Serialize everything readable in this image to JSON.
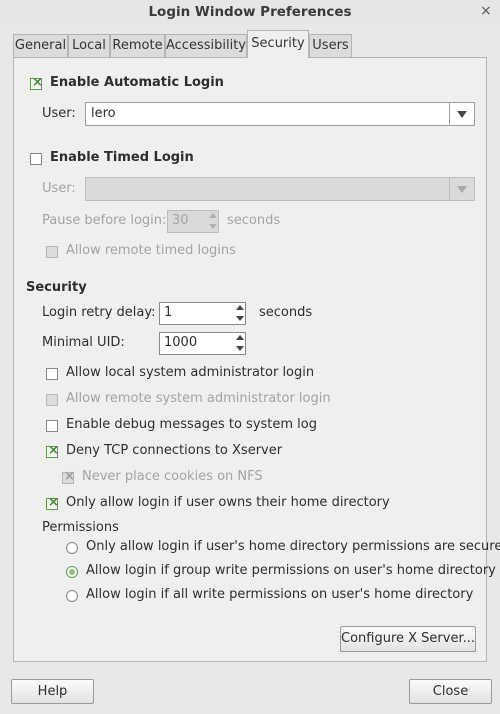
{
  "window": {
    "title": "Login Window Preferences",
    "close_glyph": "×"
  },
  "tabs": [
    {
      "label": "General"
    },
    {
      "label": "Local"
    },
    {
      "label": "Remote"
    },
    {
      "label": "Accessibility"
    },
    {
      "label": "Security",
      "active": true
    },
    {
      "label": "Users"
    }
  ],
  "auto_login": {
    "label": "Enable Automatic Login",
    "checked": true,
    "user_label": "User:",
    "user_value": "lero"
  },
  "timed_login": {
    "label": "Enable Timed Login",
    "checked": false,
    "user_label": "User:",
    "user_value": "",
    "pause_label": "Pause before login:",
    "pause_value": "30",
    "pause_unit": "seconds",
    "allow_remote_label": "Allow remote timed logins"
  },
  "security": {
    "heading": "Security",
    "retry_label": "Login retry delay:",
    "retry_value": "1",
    "retry_unit": "seconds",
    "uid_label": "Minimal UID:",
    "uid_value": "1000",
    "options": {
      "local_admin": "Allow local system administrator login",
      "remote_admin": "Allow remote system administrator login",
      "debug": "Enable debug messages to system log",
      "deny_tcp": "Deny TCP connections to Xserver",
      "cookies_nfs": "Never place cookies on NFS",
      "home_owner": "Only allow login if user owns their home directory"
    },
    "permissions_label": "Permissions",
    "permissions": [
      "Only allow login if user's home directory permissions are secure",
      "Allow login if group write permissions on user's home directory",
      "Allow login if all write permissions on user's home directory"
    ],
    "selected_permission": 1
  },
  "buttons": {
    "configure": "Configure X Server...",
    "help": "Help",
    "close": "Close"
  }
}
